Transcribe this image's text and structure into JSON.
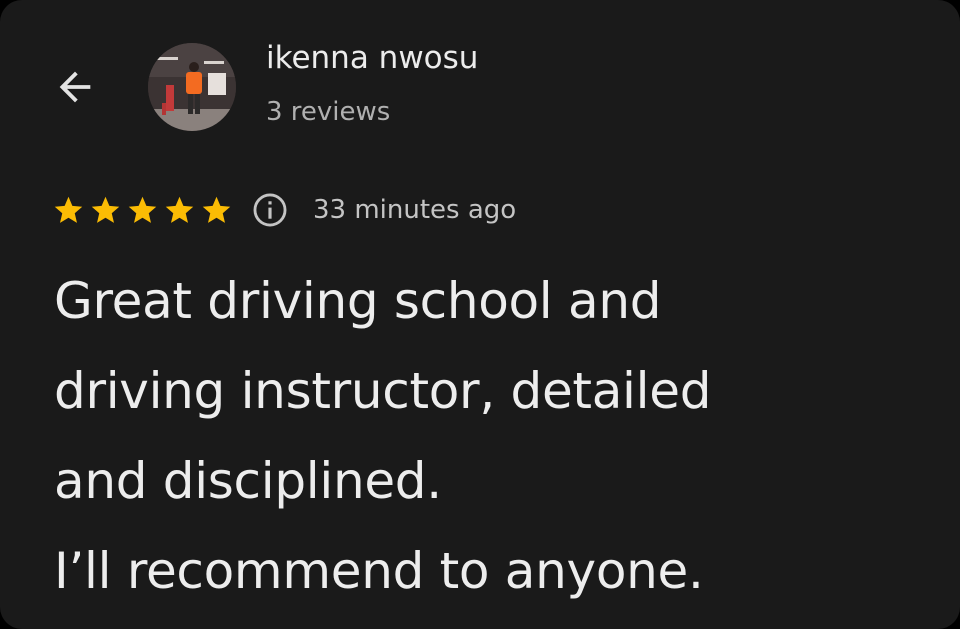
{
  "reviewer": {
    "name": "ikenna nwosu",
    "review_count": "3 reviews"
  },
  "review": {
    "rating": 5,
    "rating_max": 5,
    "time_ago": "33 minutes ago",
    "text_lines": [
      "Great driving school and",
      "driving instructor, detailed",
      "and disciplined.",
      "I’ll recommend to anyone."
    ]
  },
  "icons": {
    "back": "arrow-back-icon",
    "info": "info-icon",
    "star": "star-icon"
  },
  "colors": {
    "background": "#1a1a1a",
    "star": "#fbbc04",
    "text_primary": "#ededed",
    "text_secondary": "#b0b0b0"
  }
}
